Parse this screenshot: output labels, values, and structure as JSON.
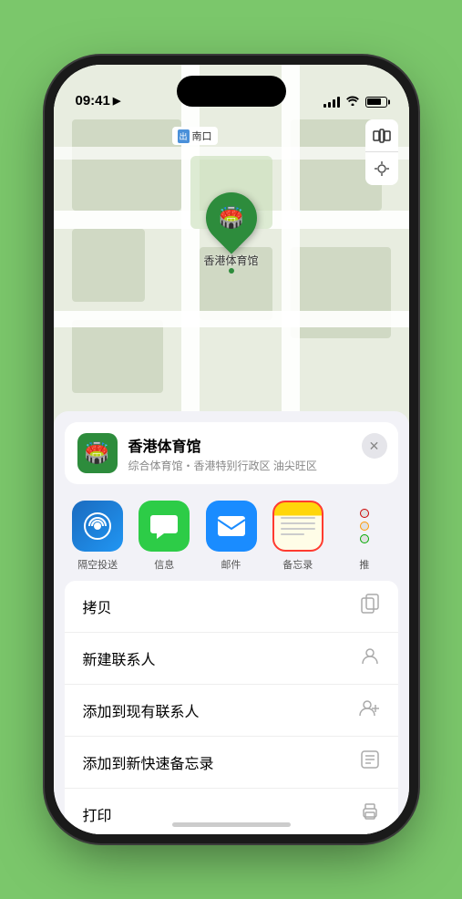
{
  "status": {
    "time": "09:41",
    "location_arrow": "▶"
  },
  "map": {
    "label_prefix": "出",
    "label_text": "南口"
  },
  "venue": {
    "name": "香港体育馆",
    "sub": "综合体育馆・香港特别行政区 油尖旺区",
    "pin_label": "香港体育馆"
  },
  "apps": [
    {
      "id": "airdrop",
      "label": "隔空投送",
      "icon": "airdrop"
    },
    {
      "id": "messages",
      "label": "信息",
      "icon": "messages"
    },
    {
      "id": "mail",
      "label": "邮件",
      "icon": "mail"
    },
    {
      "id": "notes",
      "label": "备忘录",
      "icon": "notes",
      "selected": true
    }
  ],
  "actions": [
    {
      "label": "拷贝",
      "icon": "copy"
    },
    {
      "label": "新建联系人",
      "icon": "person"
    },
    {
      "label": "添加到现有联系人",
      "icon": "person-add"
    },
    {
      "label": "添加到新快速备忘录",
      "icon": "note"
    },
    {
      "label": "打印",
      "icon": "print"
    }
  ],
  "colors": {
    "green_bg": "#7bc76b",
    "map_bg": "#e8ede0",
    "pin_green": "#2d8c3c",
    "selected_red": "#ff3b30"
  }
}
